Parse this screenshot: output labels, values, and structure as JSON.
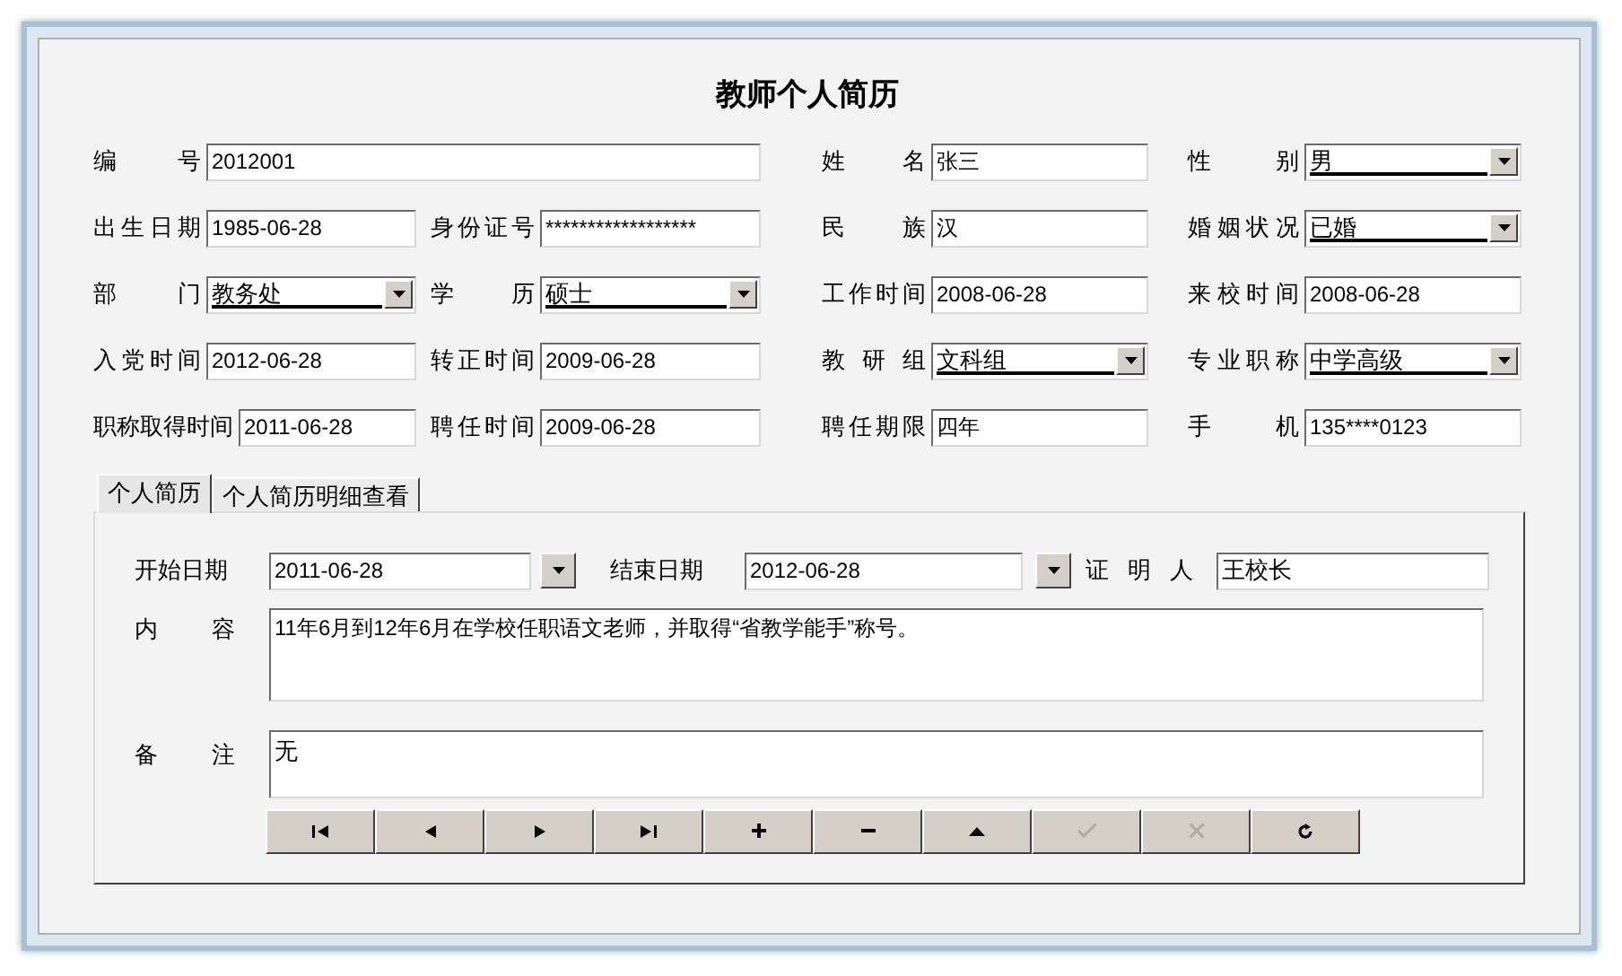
{
  "title": "教师个人简历",
  "rows": [
    [
      {
        "label": "编 号",
        "kind": "text",
        "value": "2012001"
      },
      {
        "label": "姓 名",
        "kind": "text",
        "value": "张三"
      },
      {
        "label": "性 别",
        "kind": "select",
        "value": "男"
      }
    ],
    [
      {
        "label": "出生日期",
        "kind": "text",
        "value": "1985-06-28"
      },
      {
        "label": "身份证号",
        "kind": "text",
        "value": "******************"
      },
      {
        "label": "民 族",
        "kind": "text",
        "value": "汉"
      },
      {
        "label": "婚姻状况",
        "kind": "select",
        "value": "已婚"
      }
    ],
    [
      {
        "label": "部 门",
        "kind": "select",
        "value": "教务处"
      },
      {
        "label": "学 历",
        "kind": "select",
        "value": "硕士"
      },
      {
        "label": "工作时间",
        "kind": "text",
        "value": "2008-06-28"
      },
      {
        "label": "来校时间",
        "kind": "text",
        "value": "2008-06-28"
      }
    ],
    [
      {
        "label": "入党时间",
        "kind": "text",
        "value": "2012-06-28"
      },
      {
        "label": "转正时间",
        "kind": "text",
        "value": "2009-06-28"
      },
      {
        "label": "教 研 组",
        "kind": "select",
        "value": "文科组"
      },
      {
        "label": "专业职称",
        "kind": "select",
        "value": "中学高级"
      }
    ],
    [
      {
        "label": "职称取得时间",
        "kind": "text",
        "value": "2011-06-28"
      },
      {
        "label": "聘任时间",
        "kind": "text",
        "value": "2009-06-28"
      },
      {
        "label": "聘任期限",
        "kind": "text",
        "value": "四年"
      },
      {
        "label": "手 机",
        "kind": "text",
        "value": "135****0123"
      }
    ]
  ],
  "tabs": [
    {
      "label": "个人简历",
      "selected": true
    },
    {
      "label": "个人简历明细查看",
      "selected": false
    }
  ],
  "resume": {
    "start_label": "开始日期",
    "start": "2011-06-28",
    "end_label": "结束日期",
    "end": "2012-06-28",
    "witness_label": "证 明 人",
    "witness": "王校长",
    "content_label": "内 容",
    "content": "11年6月到12年6月在学校任职语文老师，并取得“省教学能手”称号。",
    "remark_label": "备 注",
    "remark": "无"
  },
  "nav_buttons": [
    {
      "kind": "first",
      "disabled": false
    },
    {
      "kind": "prev",
      "disabled": false
    },
    {
      "kind": "next",
      "disabled": false
    },
    {
      "kind": "last",
      "disabled": false
    },
    {
      "kind": "add",
      "disabled": false
    },
    {
      "kind": "delete",
      "disabled": false
    },
    {
      "kind": "up",
      "disabled": false
    },
    {
      "kind": "save",
      "disabled": true
    },
    {
      "kind": "cancel",
      "disabled": true
    },
    {
      "kind": "refresh",
      "disabled": false
    }
  ]
}
